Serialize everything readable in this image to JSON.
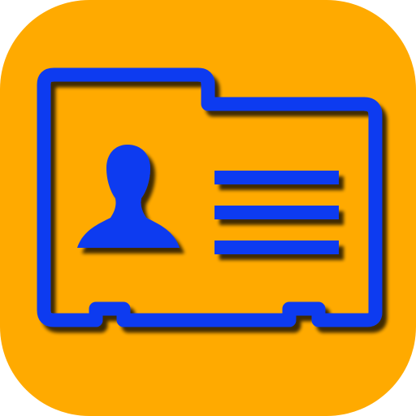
{
  "icon": {
    "name": "contact-card-icon",
    "colors": {
      "background": "#FFAA00",
      "glyph": "#0A3AF0",
      "shadow": "#5A3A00"
    }
  }
}
